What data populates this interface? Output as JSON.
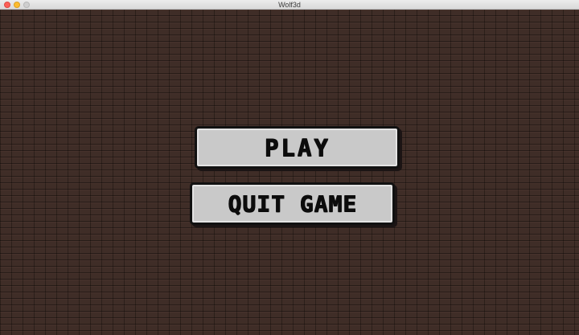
{
  "window": {
    "title": "Wolf3d"
  },
  "menu": {
    "play_label": "PLAY",
    "quit_label": "QUIT GAME"
  },
  "colors": {
    "wall": "#3f2d27",
    "button_face": "#c9c9c9",
    "button_border": "#111111"
  }
}
